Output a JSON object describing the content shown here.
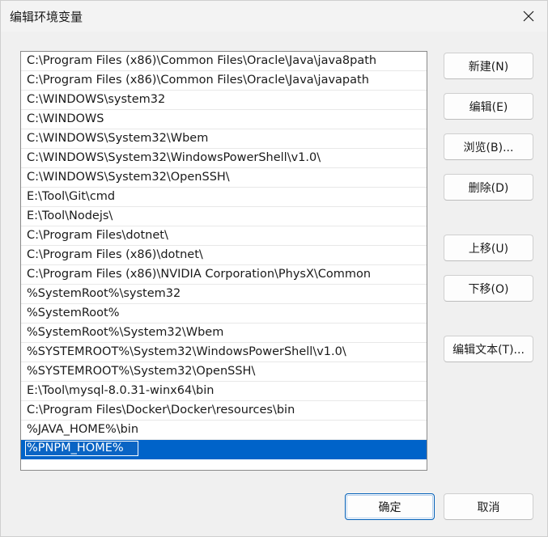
{
  "window": {
    "title": "编辑环境变量"
  },
  "paths": [
    "C:\\Program Files (x86)\\Common Files\\Oracle\\Java\\java8path",
    "C:\\Program Files (x86)\\Common Files\\Oracle\\Java\\javapath",
    "C:\\WINDOWS\\system32",
    "C:\\WINDOWS",
    "C:\\WINDOWS\\System32\\Wbem",
    "C:\\WINDOWS\\System32\\WindowsPowerShell\\v1.0\\",
    "C:\\WINDOWS\\System32\\OpenSSH\\",
    "E:\\Tool\\Git\\cmd",
    "E:\\Tool\\Nodejs\\",
    "C:\\Program Files\\dotnet\\",
    "C:\\Program Files (x86)\\dotnet\\",
    "C:\\Program Files (x86)\\NVIDIA Corporation\\PhysX\\Common",
    "%SystemRoot%\\system32",
    "%SystemRoot%",
    "%SystemRoot%\\System32\\Wbem",
    "%SYSTEMROOT%\\System32\\WindowsPowerShell\\v1.0\\",
    "%SYSTEMROOT%\\System32\\OpenSSH\\",
    "E:\\Tool\\mysql-8.0.31-winx64\\bin",
    "C:\\Program Files\\Docker\\Docker\\resources\\bin",
    "%JAVA_HOME%\\bin"
  ],
  "editing_value": "%PNPM_HOME%",
  "buttons": {
    "new": "新建(N)",
    "edit": "编辑(E)",
    "browse": "浏览(B)...",
    "delete": "删除(D)",
    "move_up": "上移(U)",
    "move_down": "下移(O)",
    "edit_text": "编辑文本(T)...",
    "ok": "确定",
    "cancel": "取消"
  }
}
